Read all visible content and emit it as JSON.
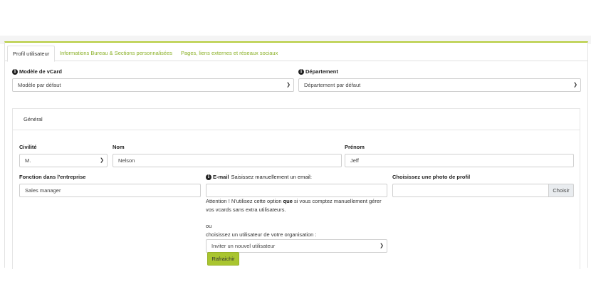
{
  "tabs": [
    {
      "label": "Profil utilisateur"
    },
    {
      "label": "Informations Bureau & Sections personnalisées"
    },
    {
      "label": "Pages, liens externes et réseaux sociaux"
    }
  ],
  "vcard_model": {
    "label": "Modèle de vCard",
    "value": "Modèle par défaut"
  },
  "department": {
    "label": "Département",
    "value": "Département par défaut"
  },
  "general": {
    "title": "Général"
  },
  "civility": {
    "label": "Civilité",
    "value": "M."
  },
  "last_name": {
    "label": "Nom",
    "value": "Nelson"
  },
  "first_name": {
    "label": "Prénom",
    "value": "Jeff"
  },
  "job": {
    "label": "Fonction dans l'entreprise",
    "value": "Sales manager"
  },
  "email": {
    "label": "E-mail",
    "hint": "Saisissez manuellement un email:",
    "value": "",
    "warning_pre": "Attention ! N'utilisez cette option ",
    "warning_bold": "que",
    "warning_post": " si vous comptez manuellement gérer",
    "warning_line2": "vos vcards sans extra utilisateurs.",
    "or": "ou",
    "choose_user": "choisissez un utilisateur de votre organisation :",
    "user_select": "Inviter un nouvel utilisateur",
    "refresh_label": "Rafraichir"
  },
  "photo": {
    "label": "Choisissez une photo de profil",
    "value": "",
    "button": "Choisir"
  },
  "colors": {
    "accent": "#a9c52f",
    "tab_link": "#8ab027"
  },
  "icons": {
    "info": "info-circle-icon",
    "dropdown": "chevron-down-icon"
  }
}
